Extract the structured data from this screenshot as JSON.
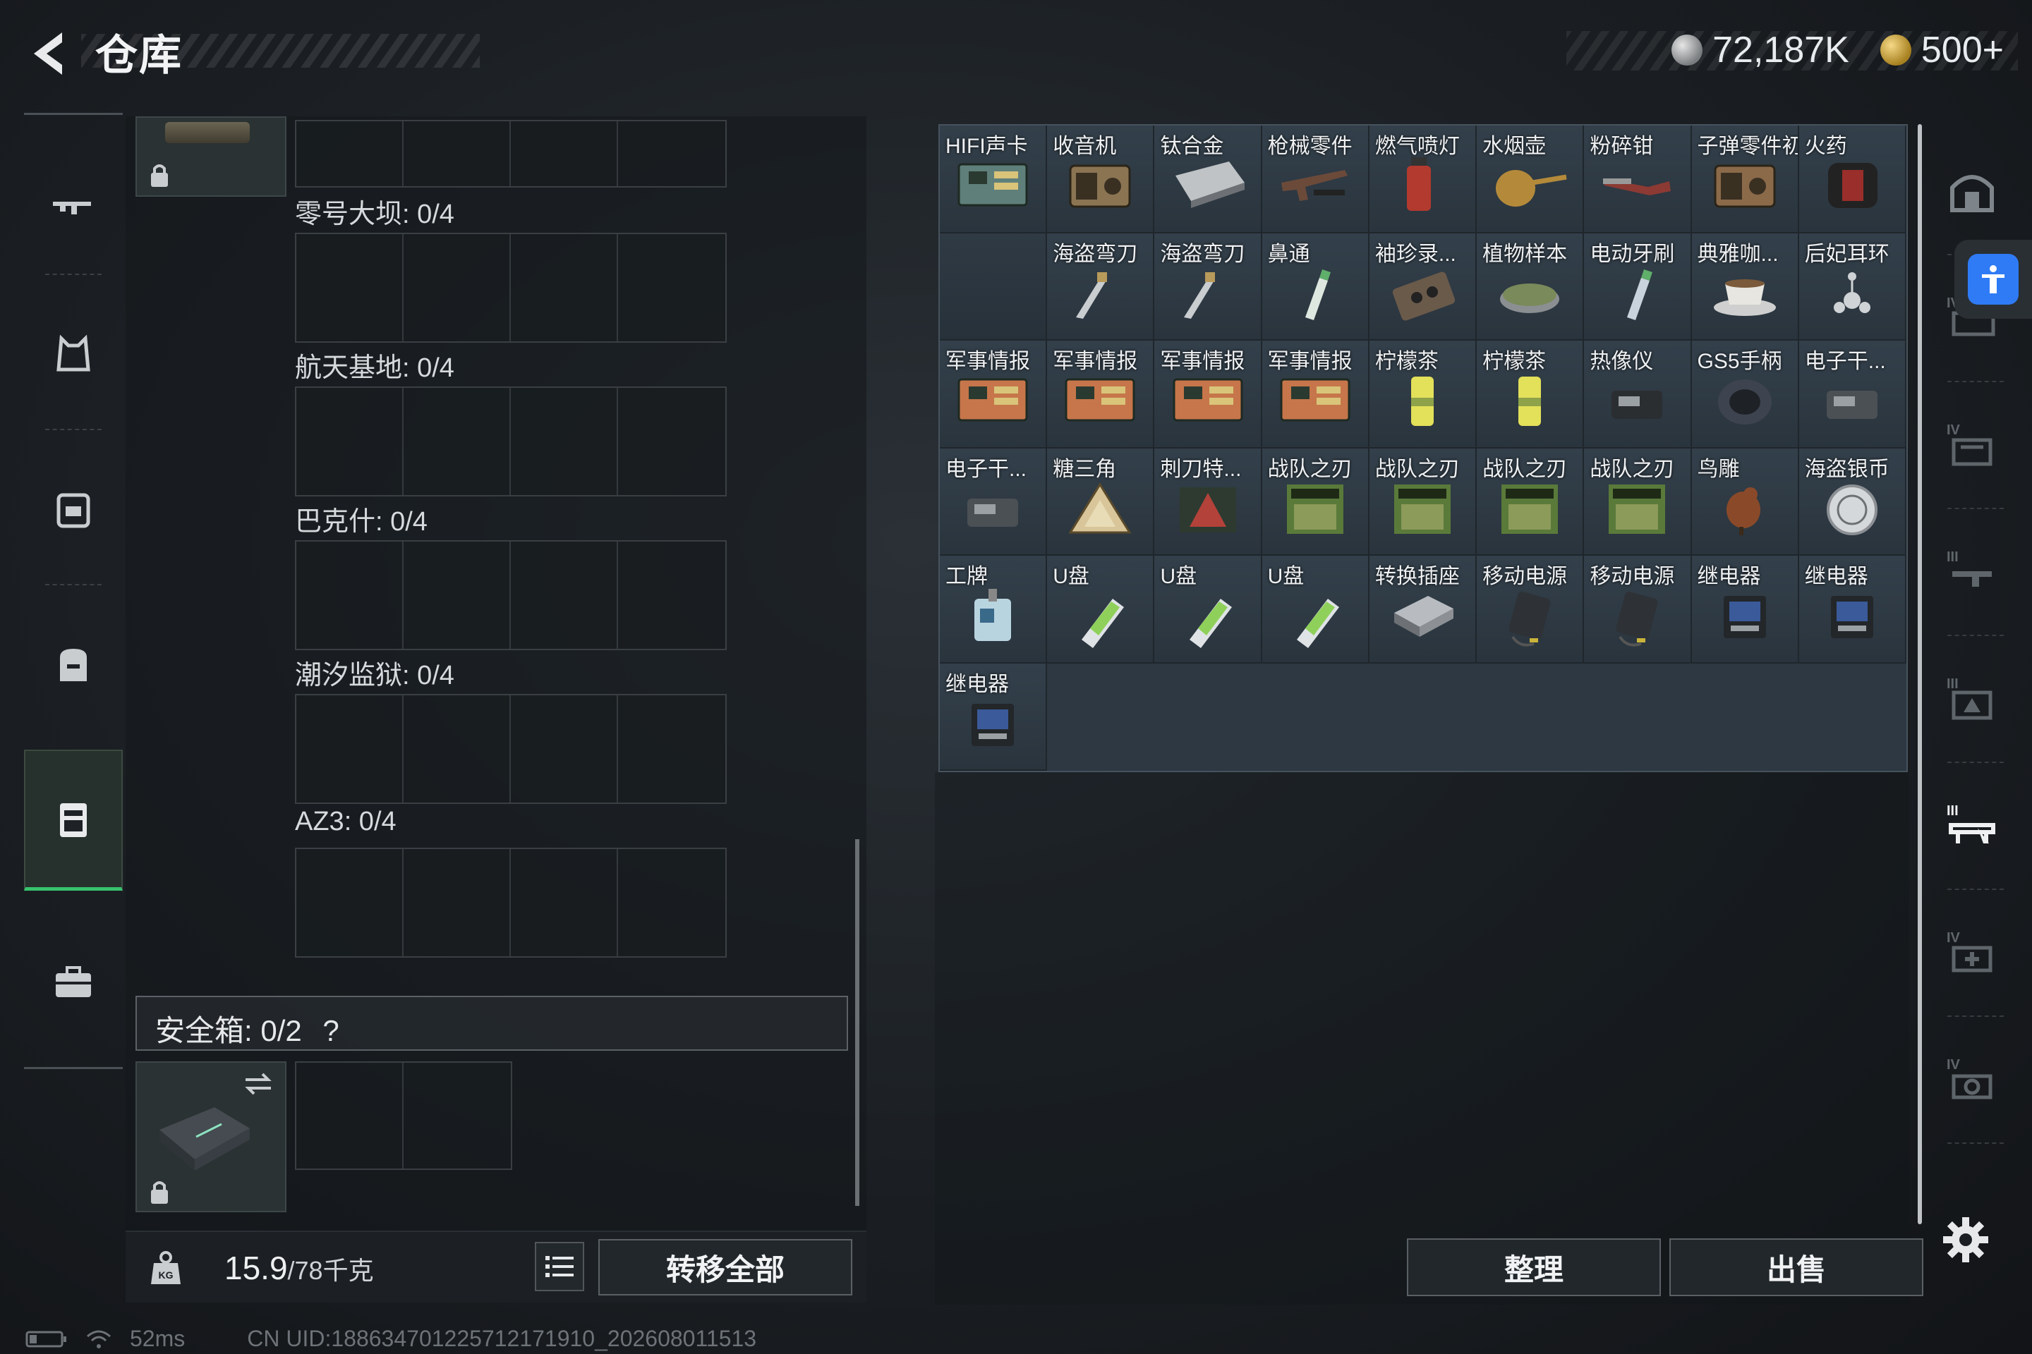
{
  "header": {
    "title": "仓库",
    "currency_silver": "72,187K",
    "currency_gold": "500+"
  },
  "left_rail": {
    "items": [
      {
        "icon": "rifle-icon"
      },
      {
        "icon": "armor-vest-icon"
      },
      {
        "icon": "chest-rig-icon"
      },
      {
        "icon": "backpack-icon"
      },
      {
        "icon": "key-case-icon",
        "active": true
      },
      {
        "icon": "briefcase-icon"
      }
    ]
  },
  "zones": [
    {
      "label": "零号大坝: 0/4"
    },
    {
      "label": "航天基地: 0/4"
    },
    {
      "label": "巴克什: 0/4"
    },
    {
      "label": "潮汐监狱: 0/4"
    },
    {
      "label": "AZ3: 0/4"
    }
  ],
  "safe_box": {
    "label": "安全箱: 0/2",
    "help": "?"
  },
  "footer": {
    "weight": "15.9",
    "weight_max": "/78千克",
    "transfer_all": "转移全部"
  },
  "status": {
    "ping": "52ms",
    "uid": "CN UID:1886347012257121719​10_202608011513"
  },
  "inventory": {
    "items": [
      {
        "name": "HIFI声卡",
        "color": "#5f7f7a",
        "shape": "board"
      },
      {
        "name": "收音机",
        "color": "#8a7452",
        "shape": "box"
      },
      {
        "name": "钛合金",
        "color": "#bfc3c5",
        "shape": "slab"
      },
      {
        "name": "枪械零件",
        "color": "#6b4a3a",
        "shape": "gun"
      },
      {
        "name": "燃气喷灯",
        "color": "#b23a2e",
        "shape": "can"
      },
      {
        "name": "水烟壶",
        "color": "#b48a3a",
        "shape": "pipe"
      },
      {
        "name": "粉碎钳",
        "color": "#8c3a33",
        "shape": "tool"
      },
      {
        "name": "子弹零件初",
        "color": "#8b6a4a",
        "shape": "box"
      },
      {
        "name": "火药",
        "color": "#9a2e2a",
        "shape": "barrel"
      },
      {
        "name": "",
        "color": "#2a343d",
        "shape": "none"
      },
      {
        "name": "海盗弯刀",
        "color": "#b89a5a",
        "shape": "knife"
      },
      {
        "name": "海盗弯刀",
        "color": "#b89a5a",
        "shape": "knife"
      },
      {
        "name": "鼻通",
        "color": "#dfe8e0",
        "shape": "tube"
      },
      {
        "name": "袖珍录...",
        "color": "#6a5a4a",
        "shape": "tape"
      },
      {
        "name": "植物样本",
        "color": "#7a8a5a",
        "shape": "dish"
      },
      {
        "name": "电动牙刷",
        "color": "#c9d3dd",
        "shape": "tube"
      },
      {
        "name": "典雅咖...",
        "color": "#e8e6e0",
        "shape": "cup"
      },
      {
        "name": "后妃耳环",
        "color": "#cfd3d6",
        "shape": "jewel"
      },
      {
        "name": "军事情报",
        "color": "#c6764a",
        "shape": "board"
      },
      {
        "name": "军事情报",
        "color": "#c6764a",
        "shape": "board"
      },
      {
        "name": "军事情报",
        "color": "#c6764a",
        "shape": "board"
      },
      {
        "name": "军事情报",
        "color": "#c6764a",
        "shape": "board"
      },
      {
        "name": "柠檬茶",
        "color": "#e3e05a",
        "shape": "canny"
      },
      {
        "name": "柠檬茶",
        "color": "#e3e05a",
        "shape": "canny"
      },
      {
        "name": "热像仪",
        "color": "#2b2e31",
        "shape": "device"
      },
      {
        "name": "GS5手柄",
        "color": "#3d4450",
        "shape": "pad"
      },
      {
        "name": "电子干...",
        "color": "#4b5054",
        "shape": "device"
      },
      {
        "name": "电子干...",
        "color": "#4b5054",
        "shape": "device"
      },
      {
        "name": "糖三角",
        "color": "#d8c69a",
        "shape": "triangle"
      },
      {
        "name": "刺刀特...",
        "color": "#b3423a",
        "shape": "cardtri"
      },
      {
        "name": "战队之刃",
        "color": "#5a7a3a",
        "shape": "card"
      },
      {
        "name": "战队之刃",
        "color": "#5a7a3a",
        "shape": "card"
      },
      {
        "name": "战队之刃",
        "color": "#5a7a3a",
        "shape": "card"
      },
      {
        "name": "战队之刃",
        "color": "#5a7a3a",
        "shape": "card"
      },
      {
        "name": "鸟雕",
        "color": "#8a4a2a",
        "shape": "bird"
      },
      {
        "name": "海盗银币",
        "color": "#d5d8da",
        "shape": "coin"
      },
      {
        "name": "工牌",
        "color": "#b8d4df",
        "shape": "badge"
      },
      {
        "name": "U盘",
        "color": "#8fd05a",
        "shape": "usb"
      },
      {
        "name": "U盘",
        "color": "#8fd05a",
        "shape": "usb"
      },
      {
        "name": "U盘",
        "color": "#8fd05a",
        "shape": "usb"
      },
      {
        "name": "转换插座",
        "color": "#b8bcc0",
        "shape": "socket"
      },
      {
        "name": "移动电源",
        "color": "#2e3236",
        "shape": "bank"
      },
      {
        "name": "移动电源",
        "color": "#2e3236",
        "shape": "bank"
      },
      {
        "name": "继电器",
        "color": "#3a5a9a",
        "shape": "relay"
      },
      {
        "name": "继电器",
        "color": "#3a5a9a",
        "shape": "relay"
      },
      {
        "name": "继电器",
        "color": "#3a5a9a",
        "shape": "relay"
      }
    ],
    "sort": "整理",
    "sell": "出售"
  },
  "right_rail": {
    "items": [
      {
        "icon": "safehouse-icon"
      },
      {
        "icon": "workbench-iv-icon"
      },
      {
        "icon": "storage-iv-icon"
      },
      {
        "icon": "weapon-rack-iii-icon"
      },
      {
        "icon": "gear-rack-iii-icon"
      },
      {
        "icon": "bench-iii-icon",
        "active": true
      },
      {
        "icon": "medical-iv-icon"
      },
      {
        "icon": "camera-iv-icon"
      }
    ]
  }
}
